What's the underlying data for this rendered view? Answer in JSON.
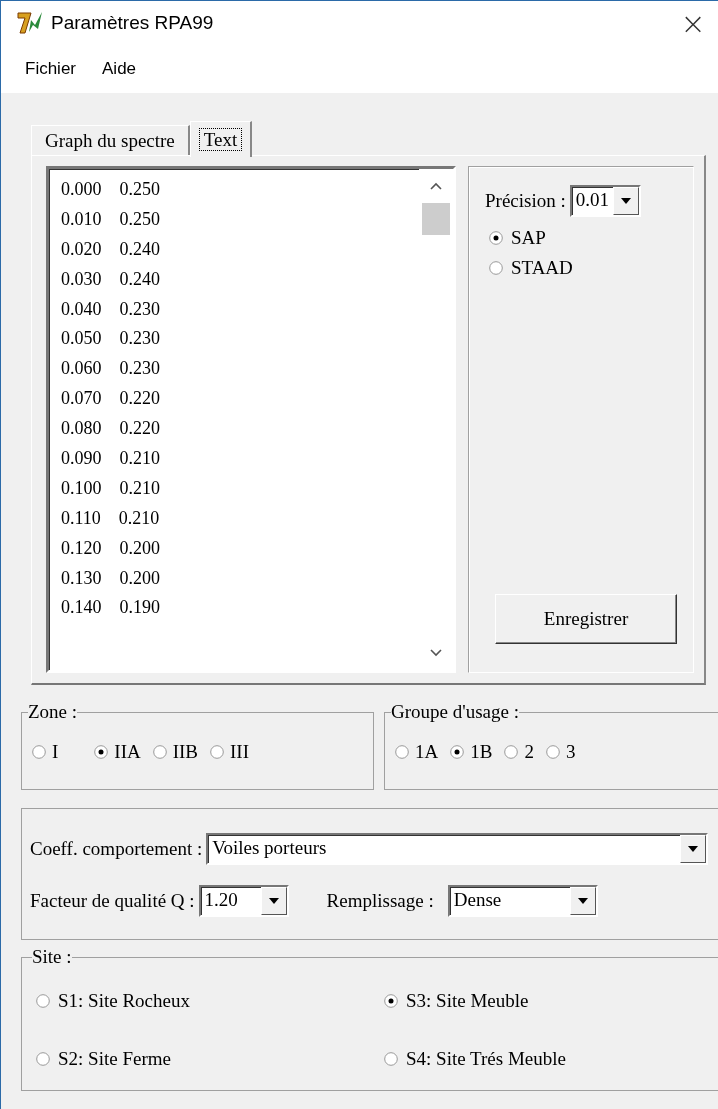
{
  "window": {
    "title": "Paramètres RPA99",
    "close": "×"
  },
  "menu": [
    "Fichier",
    "Aide"
  ],
  "tabs": [
    {
      "label": "Graph du spectre",
      "selected": false
    },
    {
      "label": "Text",
      "selected": true
    }
  ],
  "spectrum_list": [
    [
      "0.000",
      "0.250"
    ],
    [
      "0.010",
      "0.250"
    ],
    [
      "0.020",
      "0.240"
    ],
    [
      "0.030",
      "0.240"
    ],
    [
      "0.040",
      "0.230"
    ],
    [
      "0.050",
      "0.230"
    ],
    [
      "0.060",
      "0.230"
    ],
    [
      "0.070",
      "0.220"
    ],
    [
      "0.080",
      "0.220"
    ],
    [
      "0.090",
      "0.210"
    ],
    [
      "0.100",
      "0.210"
    ],
    [
      "0.110",
      "0.210"
    ],
    [
      "0.120",
      "0.200"
    ],
    [
      "0.130",
      "0.200"
    ],
    [
      "0.140",
      "0.190"
    ]
  ],
  "precision": {
    "label": "Précision :",
    "value": "0.01"
  },
  "format": [
    {
      "label": "SAP",
      "selected": true
    },
    {
      "label": "STAAD",
      "selected": false
    }
  ],
  "save_button": "Enregistrer",
  "zone": {
    "title": "Zone :",
    "options": [
      {
        "label": "I",
        "selected": false
      },
      {
        "label": "IIA",
        "selected": true
      },
      {
        "label": "IIB",
        "selected": false
      },
      {
        "label": "III",
        "selected": false
      }
    ]
  },
  "usage_group": {
    "title": "Groupe d'usage :",
    "options": [
      {
        "label": "1A",
        "selected": false
      },
      {
        "label": "1B",
        "selected": true
      },
      {
        "label": "2",
        "selected": false
      },
      {
        "label": "3",
        "selected": false
      }
    ]
  },
  "behavior_coeff": {
    "label": "Coeff. comportement :",
    "value": "Voiles porteurs"
  },
  "quality_factor": {
    "label": "Facteur de qualité Q :",
    "value": "1.20"
  },
  "filling": {
    "label": "Remplissage :",
    "value": "Dense"
  },
  "site": {
    "title": "Site :",
    "options": [
      {
        "label": "S1: Site Rocheux",
        "selected": false
      },
      {
        "label": "S3: Site Meuble",
        "selected": true
      },
      {
        "label": "S2: Site Ferme",
        "selected": false
      },
      {
        "label": "S4: Site Trés Meuble",
        "selected": false
      }
    ]
  }
}
